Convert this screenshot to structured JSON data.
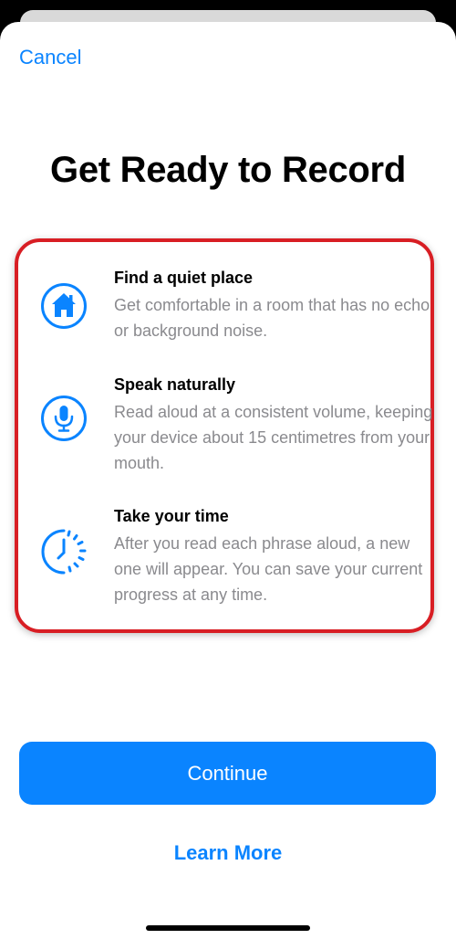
{
  "sheet": {
    "cancel_label": "Cancel",
    "title": "Get Ready to Record"
  },
  "features": [
    {
      "icon": "house-icon",
      "title": "Find a quiet place",
      "body": "Get comfortable in a room that has no echo or background noise."
    },
    {
      "icon": "microphone-icon",
      "title": "Speak naturally",
      "body": "Read aloud at a consistent volume, keeping your device about 15 centimetres from your mouth."
    },
    {
      "icon": "progress-timer-icon",
      "title": "Take your time",
      "body": "After you read each phrase aloud, a new one will appear. You can save your current progress at any time."
    }
  ],
  "actions": {
    "continue_label": "Continue",
    "learn_more_label": "Learn More"
  },
  "colors": {
    "accent": "#0a84ff",
    "highlight_border": "#d81e24",
    "secondary_text": "#8a8a8e"
  }
}
